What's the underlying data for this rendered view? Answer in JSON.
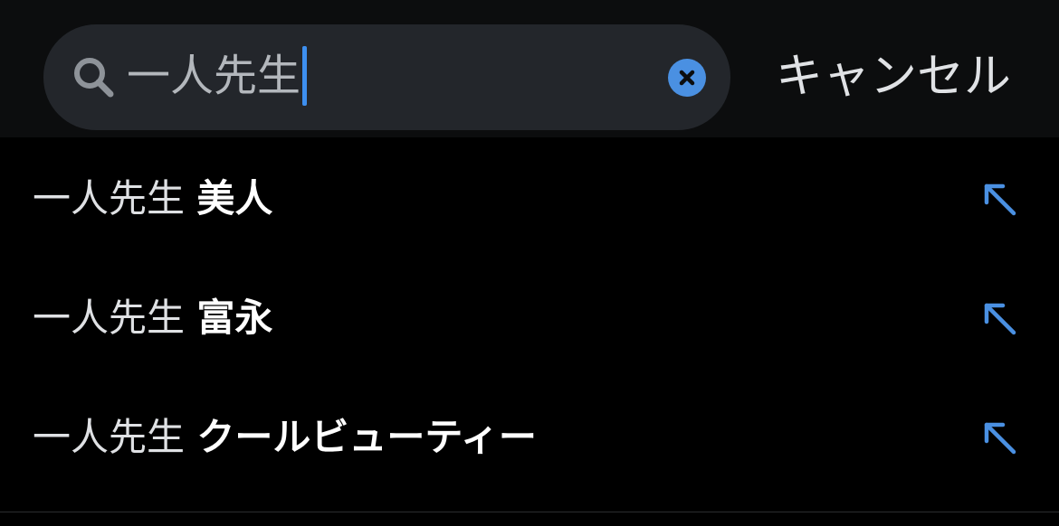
{
  "search": {
    "query": "一人先生",
    "clear_icon": "close-circle-icon",
    "search_icon": "search-icon"
  },
  "cancel_label": "キャンセル",
  "suggestions": [
    {
      "prefix": "一人先生",
      "completion": "美人"
    },
    {
      "prefix": "一人先生",
      "completion": "富永"
    },
    {
      "prefix": "一人先生",
      "completion": "クールビューティー"
    }
  ],
  "colors": {
    "accent": "#4a90e2",
    "background": "#000000",
    "search_field": "#23262b"
  }
}
